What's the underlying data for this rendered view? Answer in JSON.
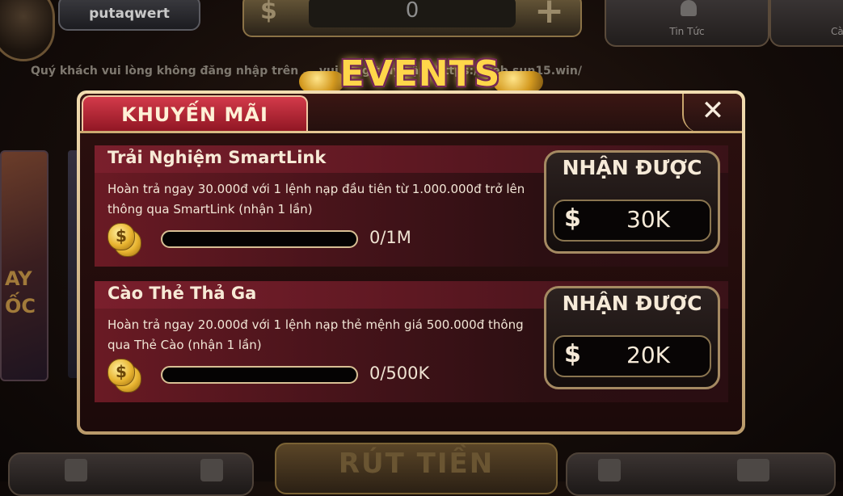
{
  "header": {
    "username": "putaqwert",
    "balance": {
      "currency_symbol": "$",
      "value": "0",
      "add_symbol": "+"
    },
    "news_label": "Tin Tức",
    "settings_label": "Cà"
  },
  "marquee": "Quý khách vui lòng không đăng nhập trên ... vui lòng truy cập: https://web.sun15.win/",
  "events_title": "EVENTS",
  "modal": {
    "tab_label": "KHUYẾN MÃI",
    "close_symbol": "✕",
    "promotions": [
      {
        "title": "Trải Nghiệm SmartLink",
        "description": "Hoàn trả ngay 30.000đ với 1 lệnh nạp đầu tiên từ 1.000.000đ trở lên thông qua SmartLink (nhận 1 lần)",
        "progress_text": "0/1M",
        "progress_fraction": 0,
        "reward_label": "NHẬN ĐƯỢC",
        "reward_currency": "$",
        "reward_amount": "30K"
      },
      {
        "title": "Cào Thẻ Thả Ga",
        "description": "Hoàn trả ngay 20.000đ với 1 lệnh nạp thẻ mệnh giá 500.000đ thông qua Thẻ Cào (nhận 1 lần)",
        "progress_text": "0/500K",
        "progress_fraction": 0,
        "reward_label": "NHẬN ĐƯỢC",
        "reward_currency": "$",
        "reward_amount": "20K"
      }
    ]
  },
  "bottom": {
    "withdraw_label": "RÚT TIỀN"
  },
  "side_banner_text": "AY ỐC",
  "colors": {
    "gold": "#ffd64a",
    "tab_red": "#d33a4a",
    "card_red": "#6a1a24",
    "frame": "#efd3a0"
  }
}
